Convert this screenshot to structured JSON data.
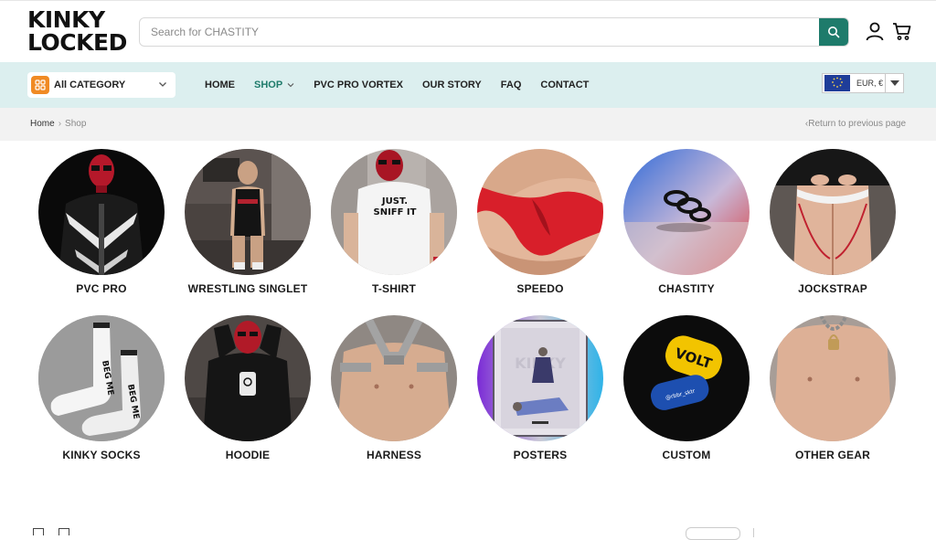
{
  "brand": {
    "line1": "KINKY",
    "line2": "LOCKED"
  },
  "search": {
    "placeholder": "Search for CHASTITY"
  },
  "category_select": {
    "label": "All CATEGORY"
  },
  "nav": {
    "items": [
      {
        "label": "HOME",
        "active": false,
        "dropdown": false
      },
      {
        "label": "SHOP",
        "active": true,
        "dropdown": true
      },
      {
        "label": "PVC PRO VORTEX",
        "active": false,
        "dropdown": false
      },
      {
        "label": "OUR STORY",
        "active": false,
        "dropdown": false
      },
      {
        "label": "FAQ",
        "active": false,
        "dropdown": false
      },
      {
        "label": "CONTACT",
        "active": false,
        "dropdown": false
      }
    ]
  },
  "currency": {
    "label": "EUR, €"
  },
  "breadcrumb": {
    "home": "Home",
    "current": "Shop",
    "return": "Return to previous page"
  },
  "categories": [
    {
      "name": "PVC PRO"
    },
    {
      "name": "WRESTLING SINGLET"
    },
    {
      "name": "T-SHIRT",
      "print": "JUST. SNIFF IT"
    },
    {
      "name": "SPEEDO"
    },
    {
      "name": "CHASTITY"
    },
    {
      "name": "JOCKSTRAP"
    },
    {
      "name": "KINKY SOCKS",
      "print": "BEG ME"
    },
    {
      "name": "HOODIE"
    },
    {
      "name": "HARNESS"
    },
    {
      "name": "POSTERS"
    },
    {
      "name": "CUSTOM",
      "tag1": "VOLT",
      "tag2": "@rbbr_sktr"
    },
    {
      "name": "OTHER GEAR"
    }
  ],
  "colors": {
    "accent": "#1e7b6b",
    "nav_bg": "#dcefef",
    "orange": "#f08a24"
  }
}
